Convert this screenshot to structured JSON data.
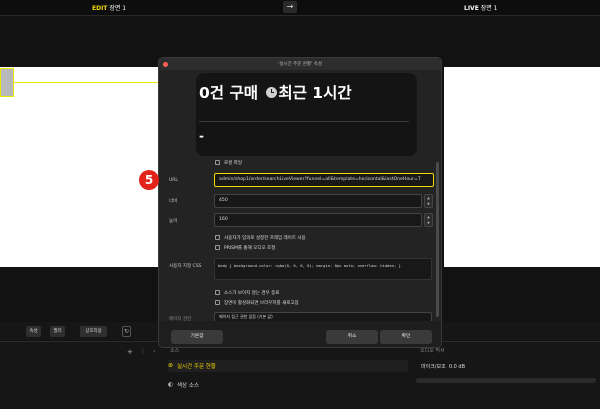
{
  "topbar": {
    "edit_prefix": "EDIT",
    "edit_scene": "장면 1",
    "live_prefix": "LIVE",
    "live_scene": "장면 1",
    "arrow": "→"
  },
  "controls": {
    "attr_button": "속성",
    "filter_button": "필터",
    "interact_button": "상호작용"
  },
  "sources": {
    "header": "소스",
    "items": [
      {
        "label": "실시간 주문 현황",
        "selected": true
      },
      {
        "label": "색상 소스",
        "selected": false
      }
    ]
  },
  "audio": {
    "header": "오디오 믹서",
    "mic_label": "마이크/보조",
    "mic_level": "0.0 dB"
  },
  "dialog": {
    "title": "'실시간 주문 현황' 속성",
    "card": {
      "count_num": "0",
      "count_text": "건 구매",
      "period": "최근 1시간",
      "dash": "-"
    },
    "local_file_label": "로컬 파일",
    "url_label": "URL",
    "url_value": "admin/shop1/order/searchLiveViewer?funnel=all&template=horizontal&lastOneHour=T",
    "width_label": "너비",
    "width_value": "450",
    "height_label": "높이",
    "height_value": "160",
    "custom_fps_label": "사용자가 임의로 설정한 프레임 레이트 사용",
    "prism_audio_label": "PRISM를 통해 오디오 조절",
    "css_label": "사용자 지정 CSS",
    "css_value": "body { background-color: rgba(0, 0, 0, 0); margin: 0px auto; overflow: hidden; }",
    "shutdown_label": "소스가 보이지 않는 경우 종료",
    "refresh_label": "장면이 활성화되면 브라우저를 새로고침",
    "page_perm_label": "페이지 권한",
    "page_perm_value": "페이지 접근 권한 없음 (기본 값)",
    "default_button": "기본값",
    "cancel_button": "취소",
    "ok_button": "확인"
  },
  "annotation": {
    "step": "5"
  }
}
